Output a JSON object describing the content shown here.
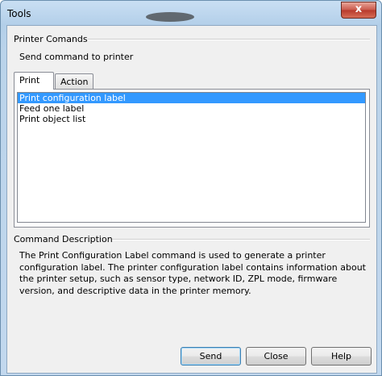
{
  "window": {
    "title": "Tools",
    "close_label": "x"
  },
  "printer_commands": {
    "section_title": "Printer Comands",
    "subtitle": "Send command to printer",
    "tabs": [
      {
        "label": "Print",
        "active": true
      },
      {
        "label": "Action",
        "active": false
      }
    ],
    "list": [
      {
        "label": "Print configuration label",
        "selected": true
      },
      {
        "label": "Feed one label",
        "selected": false
      },
      {
        "label": "Print object list",
        "selected": false
      }
    ]
  },
  "command_description": {
    "section_title": "Command Description",
    "text": "The Print Configuration Label command is used to generate a printer configuration label. The printer configuration label contains information about the printer setup, such as sensor type, network ID, ZPL mode, firmware version, and descriptive data in the printer memory."
  },
  "buttons": {
    "send": "Send",
    "close": "Close",
    "help": "Help"
  },
  "colors": {
    "selection": "#3399ff",
    "close_button": "#c9584a"
  }
}
